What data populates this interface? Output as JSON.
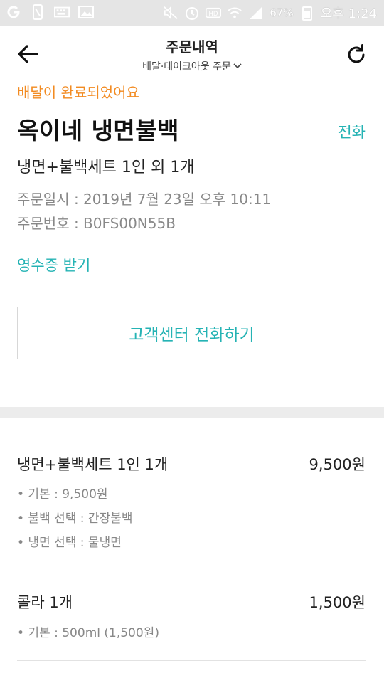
{
  "status_bar": {
    "battery": "67%",
    "time": "오후 1:24",
    "icons": [
      "g-icon",
      "phone-icon",
      "keyboard-icon",
      "image-icon",
      "mute-icon",
      "alarm-icon",
      "hd-icon",
      "wifi-icon",
      "signal-icon",
      "battery-icon"
    ]
  },
  "header": {
    "title": "주문내역",
    "subtitle": "배달·테이크아웃 주문"
  },
  "order": {
    "status": "배달이 완료되었어요",
    "store_name": "옥이네 냉면불백",
    "call_label": "전화",
    "summary": "냉면+불백세트 1인 외 1개",
    "order_datetime": "주문일시 : 2019년 7월 23일 오후 10:11",
    "order_number": "주문번호 : B0FS00N55B",
    "receipt_label": "영수증 받기",
    "cs_button_label": "고객센터 전화하기"
  },
  "items": [
    {
      "name": "냉면+불백세트 1인 1개",
      "price": "9,500원",
      "options": [
        "• 기본 : 9,500원",
        "• 불백 선택 : 간장불백",
        "• 냉면 선택 : 물냉면"
      ]
    },
    {
      "name": "콜라 1개",
      "price": "1,500원",
      "options": [
        "• 기본 : 500ml (1,500원)"
      ]
    }
  ],
  "colors": {
    "accent": "#25b3b4",
    "status_orange": "#f28b22",
    "status_bar_bg": "#e5e5e5"
  }
}
